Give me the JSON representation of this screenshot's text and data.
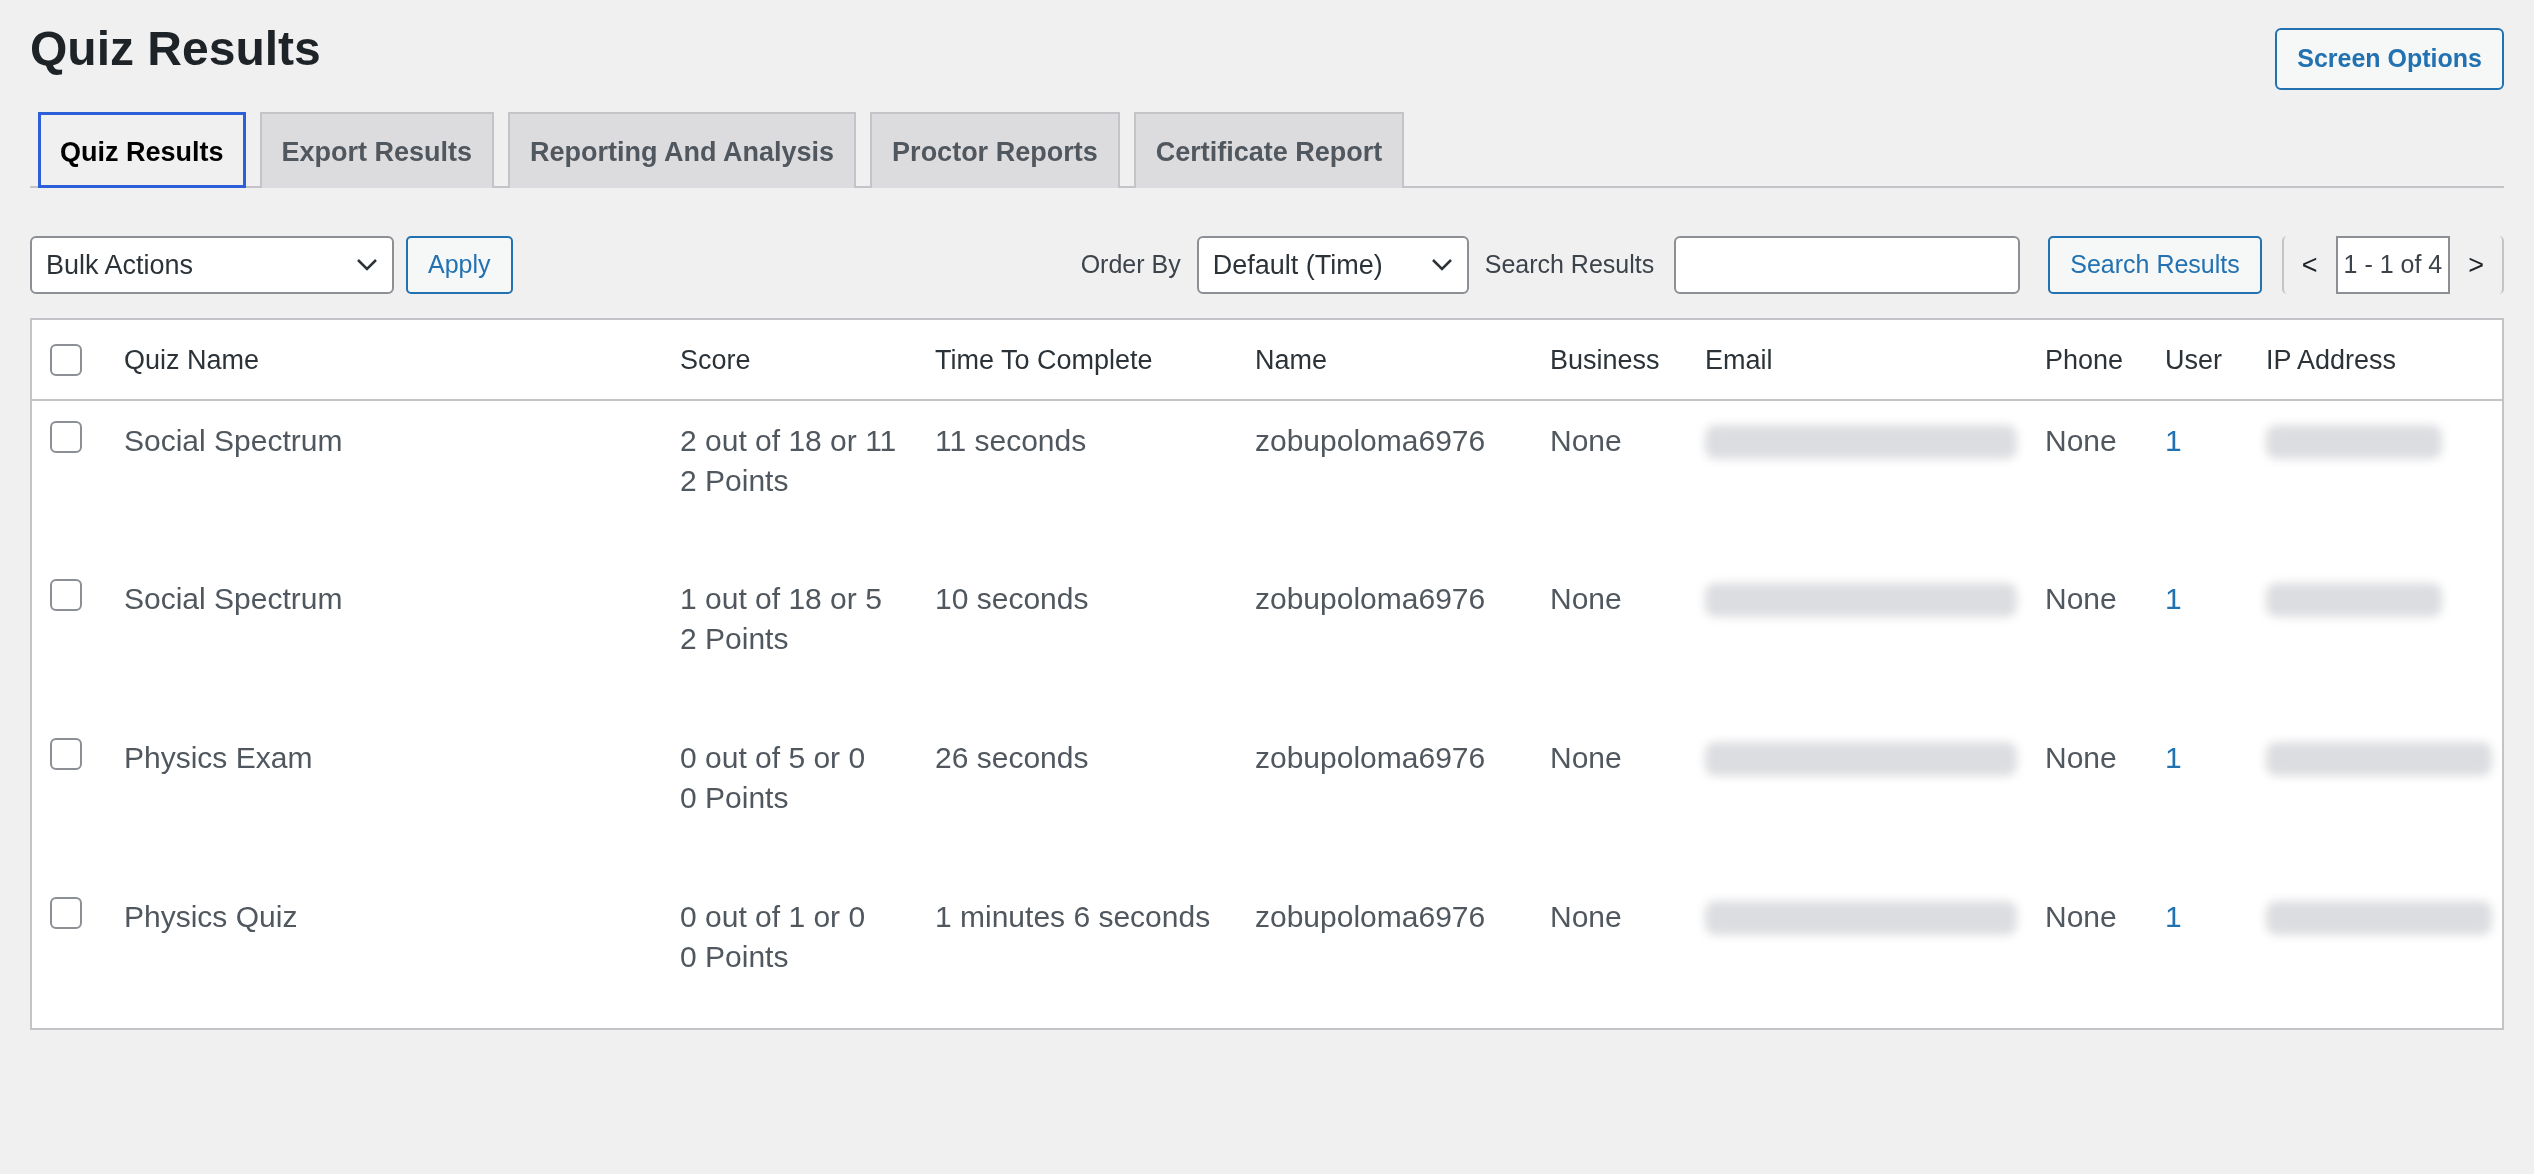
{
  "page": {
    "title": "Quiz Results",
    "screen_options": "Screen Options"
  },
  "tabs": [
    {
      "label": "Quiz Results",
      "selected": true
    },
    {
      "label": "Export Results",
      "selected": false
    },
    {
      "label": "Reporting And Analysis",
      "selected": false
    },
    {
      "label": "Proctor Reports",
      "selected": false
    },
    {
      "label": "Certificate Report",
      "selected": false
    }
  ],
  "toolbar": {
    "bulk_actions": "Bulk Actions",
    "apply": "Apply",
    "order_by_label": "Order By",
    "order_by_value": "Default (Time)",
    "search_label": "Search Results",
    "search_button": "Search Results",
    "prev": "<",
    "page_value": "1 - 1 of 4",
    "next": ">"
  },
  "table": {
    "columns": [
      "Quiz Name",
      "Score",
      "Time To Complete",
      "Name",
      "Business",
      "Email",
      "Phone",
      "User",
      "IP Address"
    ],
    "header_checked": false,
    "rows": [
      {
        "checked": false,
        "quiz_name": "Social Spectrum",
        "score": "2 out of 18 or 11",
        "points": "2 Points",
        "time": "11 seconds",
        "name": "zobupoloma6976",
        "business": "None",
        "phone": "None",
        "user": "1"
      },
      {
        "checked": false,
        "quiz_name": "Social Spectrum",
        "score": "1 out of 18 or 5",
        "points": "2 Points",
        "time": "10 seconds",
        "name": "zobupoloma6976",
        "business": "None",
        "phone": "None",
        "user": "1"
      },
      {
        "checked": false,
        "quiz_name": "Physics Exam",
        "score": "0 out of 5 or 0",
        "points": "0 Points",
        "time": "26 seconds",
        "name": "zobupoloma6976",
        "business": "None",
        "phone": "None",
        "user": "1"
      },
      {
        "checked": false,
        "quiz_name": "Physics Quiz",
        "score": "0 out of 1 or 0",
        "points": "0 Points",
        "time": "1 minutes 6 seconds",
        "name": "zobupoloma6976",
        "business": "None",
        "phone": "None",
        "user": "1"
      }
    ]
  }
}
